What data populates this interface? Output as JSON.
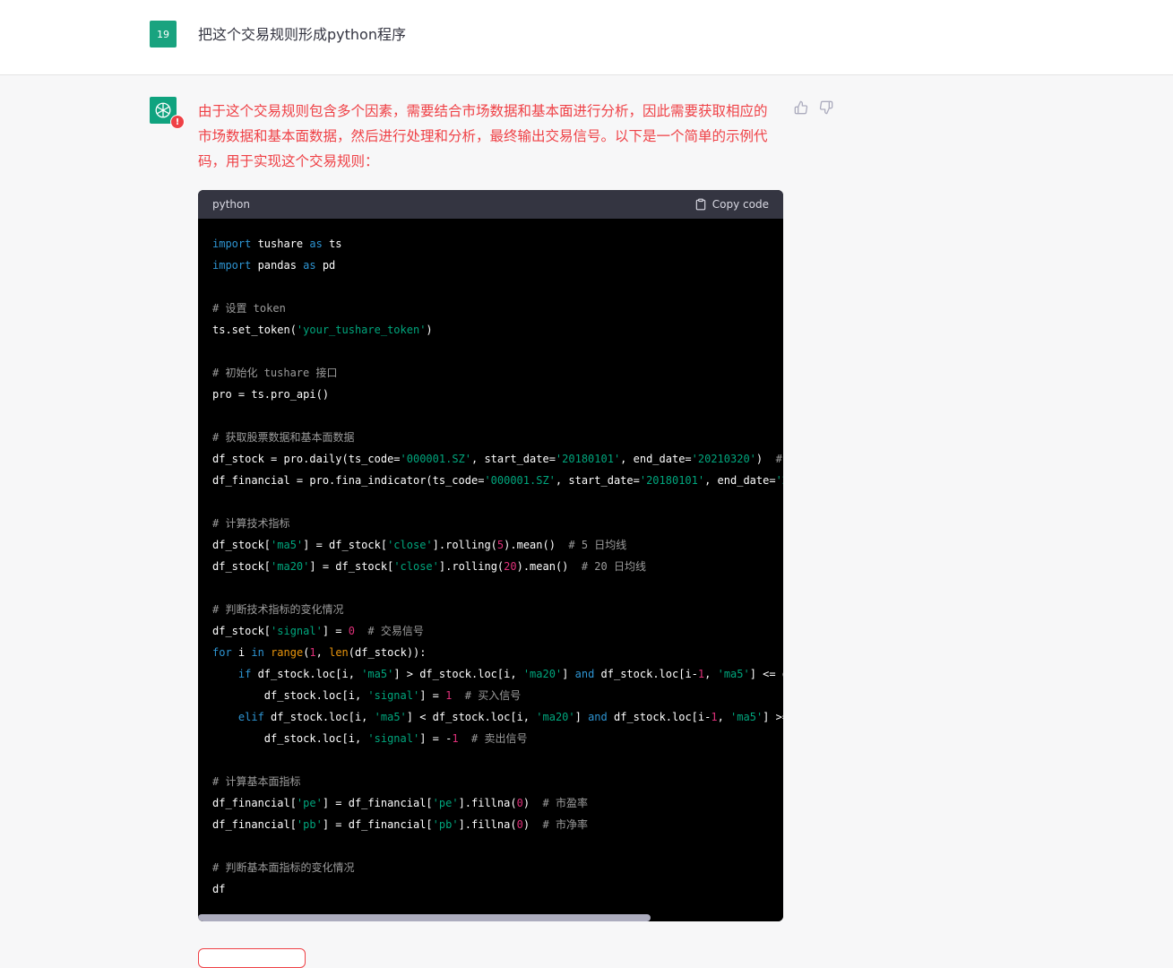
{
  "user_message": {
    "avatar_label": "19",
    "text": "把这个交易规则形成python程序"
  },
  "assistant_message": {
    "error_badge": "!",
    "text": "由于这个交易规则包含多个因素，需要结合市场数据和基本面进行分析，因此需要获取相应的市场数据和基本面数据，然后进行处理和分析，最终输出交易信号。以下是一个简单的示例代码，用于实现这个交易规则：",
    "code_block": {
      "language": "python",
      "copy_label": "Copy code"
    }
  },
  "colors": {
    "accent": "#10a37f",
    "error": "#ef4146",
    "code_bg": "#000000",
    "code_header": "#343541"
  }
}
